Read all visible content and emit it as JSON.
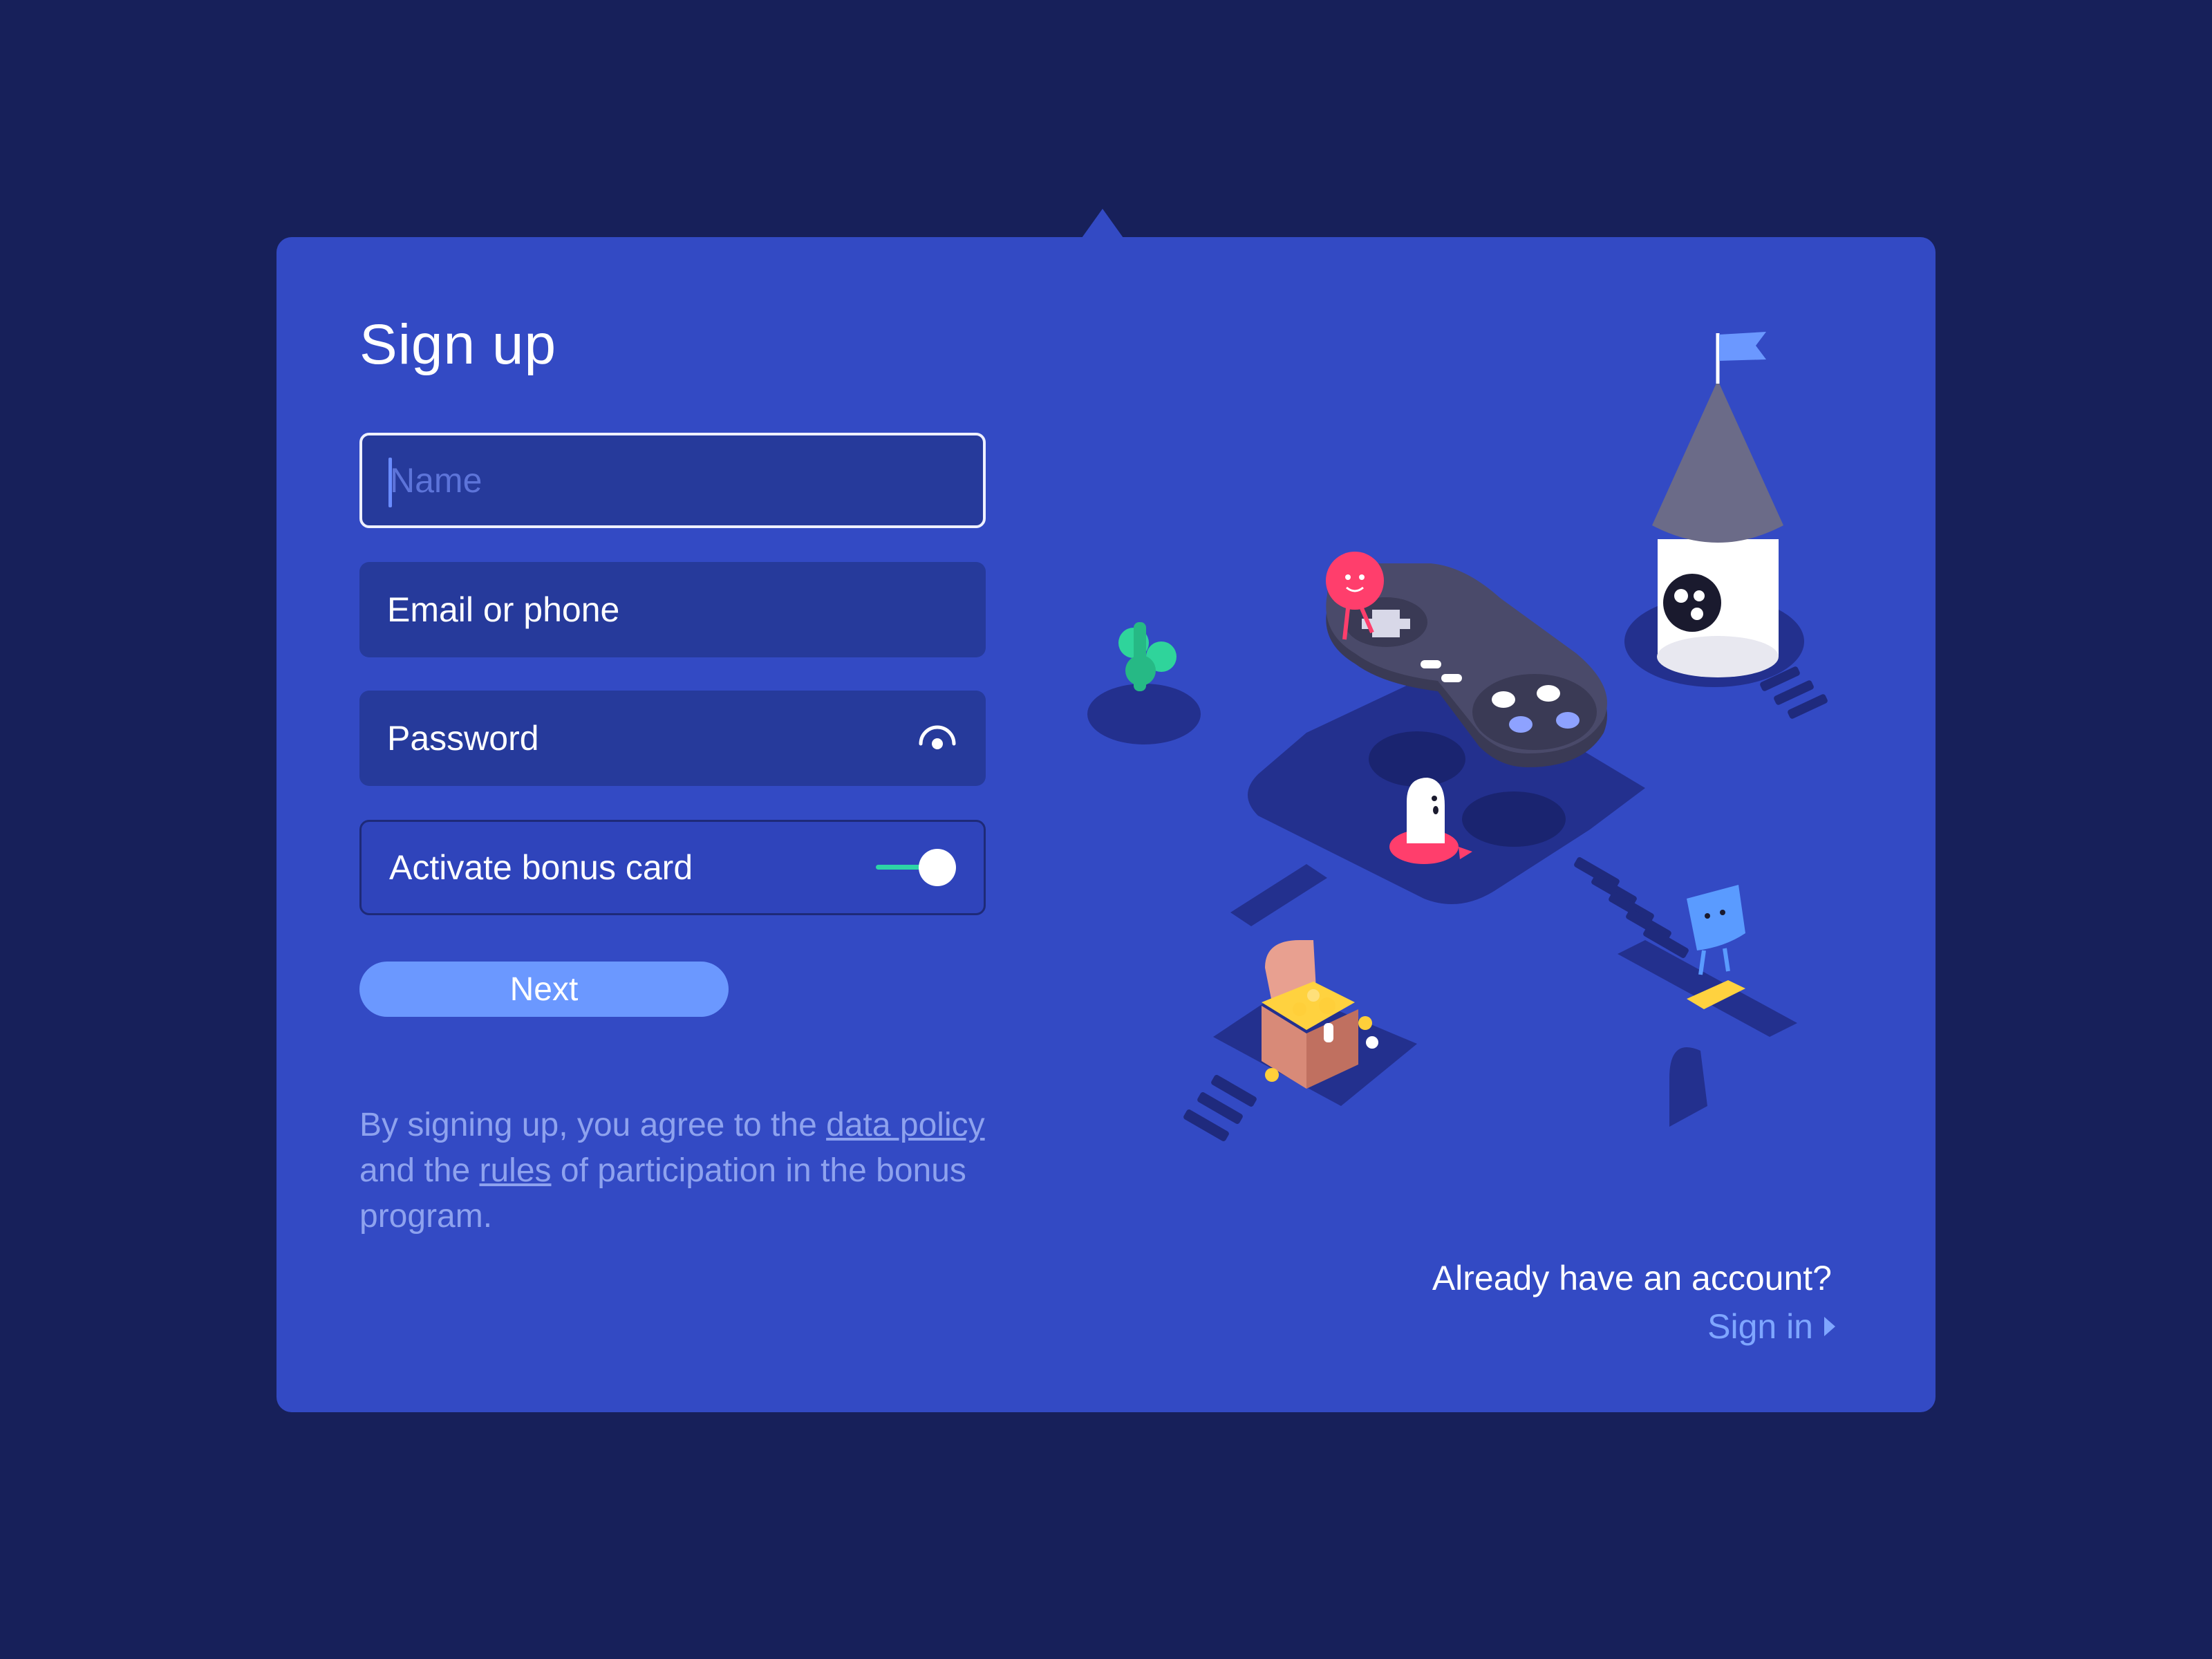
{
  "signup": {
    "title": "Sign up",
    "name_placeholder": "Name",
    "email_label": "Email or phone",
    "password_label": "Password",
    "bonus_label": "Activate bonus card",
    "bonus_enabled": true,
    "next_label": "Next"
  },
  "terms": {
    "prefix": "By signing up, you agree to the ",
    "link_data_policy": "data policy",
    "middle": " and the ",
    "link_rules": "rules",
    "suffix": " of participation in the bonus program."
  },
  "footer": {
    "already_text": "Already have an account?",
    "signin_label": "Sign in"
  },
  "icons": {
    "password_toggle": "eye-icon",
    "signin_arrow": "caret-right-icon"
  },
  "colors": {
    "page_bg": "#17205a",
    "card_bg": "#334ac4",
    "field_bg": "#263a9b",
    "accent": "#6b98ff",
    "toggle_on": "#2dd4a6"
  }
}
